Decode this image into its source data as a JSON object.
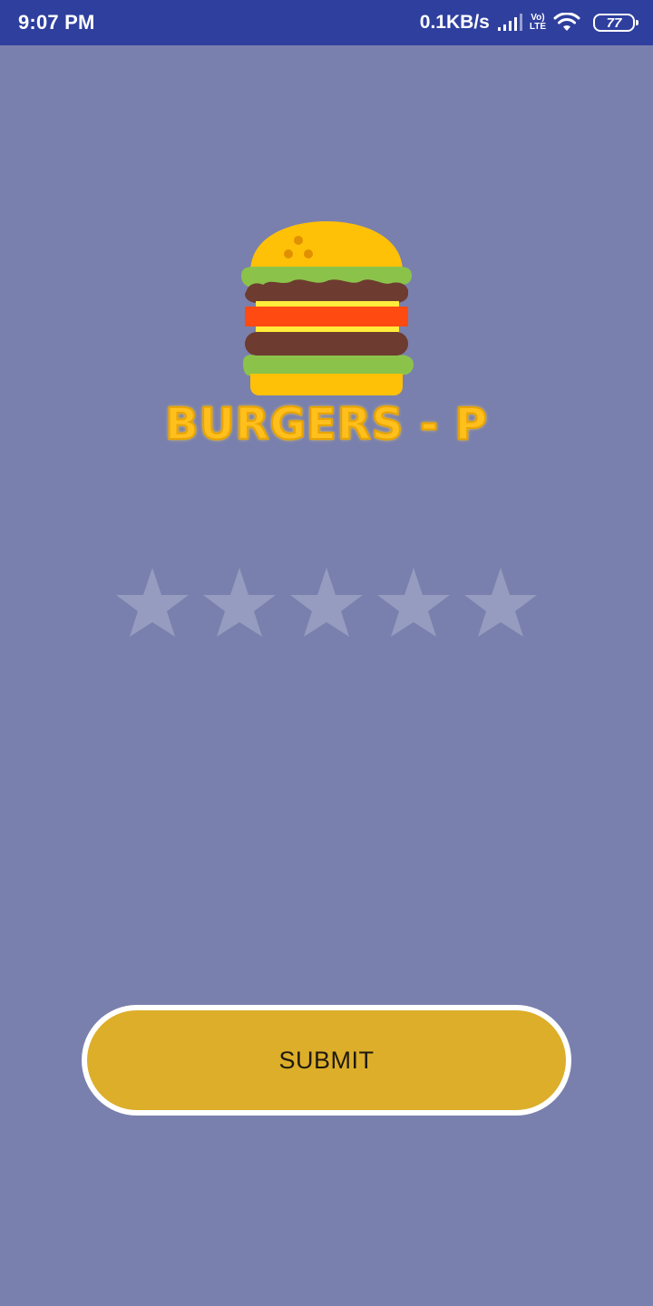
{
  "status_bar": {
    "time": "9:07 PM",
    "net_speed": "0.1KB/s",
    "volte_top": "Vo)",
    "volte_bottom": "LTE",
    "battery": "77",
    "icons": [
      "signal-icon",
      "volte-icon",
      "wifi-icon",
      "battery-icon"
    ]
  },
  "brand": {
    "logo_icon": "burger-icon",
    "name": "BURGERS - P"
  },
  "rating": {
    "max": 5,
    "value": 0,
    "star_icon": "star-icon",
    "empty_color": "#959cc0"
  },
  "submit": {
    "label": "SUBMIT"
  },
  "colors": {
    "background": "#7a80ad",
    "status_bar": "#2f3f9e",
    "button_fill": "#ddae2a",
    "button_border": "#ffffff",
    "brand_text": "#ffbf1c"
  }
}
